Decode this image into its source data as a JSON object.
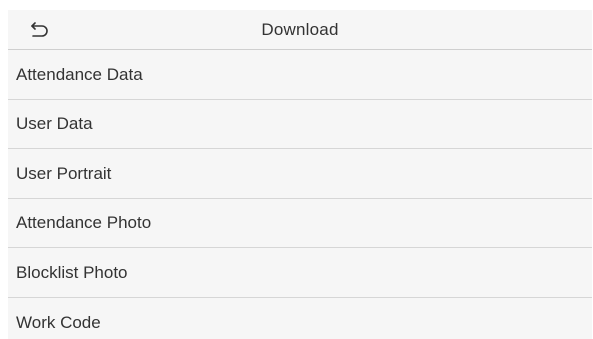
{
  "header": {
    "title": "Download",
    "back_icon": "back-return-icon"
  },
  "menu": {
    "items": [
      {
        "label": "Attendance Data"
      },
      {
        "label": "User Data"
      },
      {
        "label": "User Portrait"
      },
      {
        "label": "Attendance Photo"
      },
      {
        "label": "Blocklist Photo"
      },
      {
        "label": "Work Code"
      }
    ]
  },
  "colors": {
    "background": "#f6f6f6",
    "text": "#333333",
    "divider": "#d6d6d6"
  }
}
